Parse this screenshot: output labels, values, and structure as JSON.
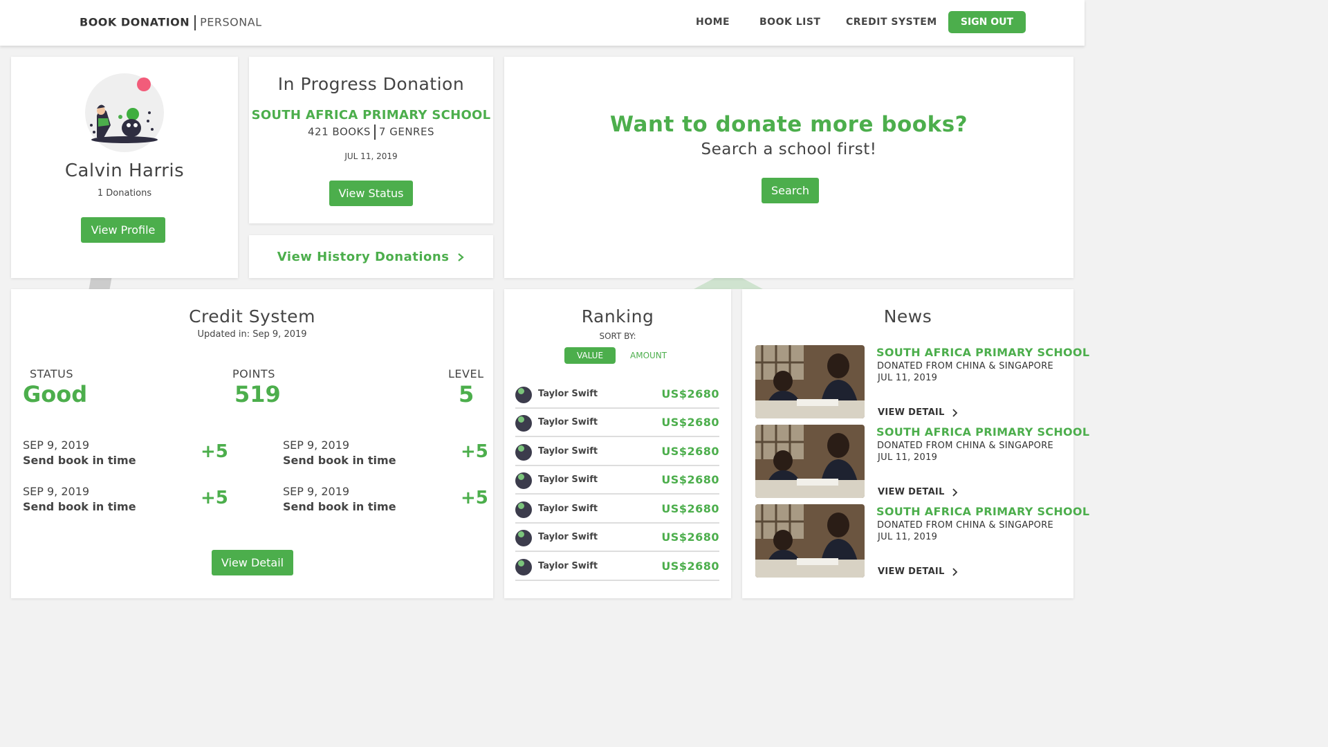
{
  "header": {
    "brand_main": "BOOK DONATION",
    "brand_sub": "PERSONAL",
    "nav": [
      "HOME",
      "BOOK LIST",
      "CREDIT SYSTEM"
    ],
    "signout": "SIGN OUT"
  },
  "profile": {
    "name": "Calvin Harris",
    "donations": "1 Donations",
    "button": "View Profile"
  },
  "in_progress": {
    "title": "In Progress Donation",
    "school": "SOUTH AFRICA PRIMARY SCHOOL",
    "books": "421 BOOKS",
    "genres": "7 GENRES",
    "date": "JUL 11, 2019",
    "button": "View Status"
  },
  "history": {
    "label": "View History Donations",
    "icon": "chevron-right-icon"
  },
  "promo": {
    "title": "Want to donate more books?",
    "subtitle": "Search a school first!",
    "button": "Search"
  },
  "credit": {
    "title": "Credit System",
    "updated": "Updated in: Sep 9, 2019",
    "status_label": "STATUS",
    "status_value": "Good",
    "points_label": "POINTS",
    "points_value": "519",
    "level_label": "LEVEL",
    "level_value": "5",
    "history": [
      {
        "date": "SEP 9, 2019",
        "desc": "Send book in time",
        "points": "+5"
      },
      {
        "date": "SEP 9, 2019",
        "desc": "Send book in time",
        "points": "+5"
      },
      {
        "date": "SEP 9, 2019",
        "desc": "Send book in time",
        "points": "+5"
      },
      {
        "date": "SEP 9, 2019",
        "desc": "Send book in time",
        "points": "+5"
      }
    ],
    "button": "View Detail"
  },
  "ranking": {
    "title": "Ranking",
    "sort_label": "SORT BY:",
    "sort_value": "VALUE",
    "sort_amount": "AMOUNT",
    "rows": [
      {
        "name": "Taylor Swift",
        "value": "US$2680"
      },
      {
        "name": "Taylor Swift",
        "value": "US$2680"
      },
      {
        "name": "Taylor Swift",
        "value": "US$2680"
      },
      {
        "name": "Taylor Swift",
        "value": "US$2680"
      },
      {
        "name": "Taylor Swift",
        "value": "US$2680"
      },
      {
        "name": "Taylor Swift",
        "value": "US$2680"
      },
      {
        "name": "Taylor Swift",
        "value": "US$2680"
      }
    ]
  },
  "news": {
    "title": "News",
    "items": [
      {
        "school": "SOUTH AFRICA PRIMARY SCHOOL",
        "from": "DONATED FROM CHINA & SINGAPORE",
        "date": "JUL 11, 2019",
        "link": "VIEW DETAIL"
      },
      {
        "school": "SOUTH AFRICA PRIMARY SCHOOL",
        "from": "DONATED FROM CHINA & SINGAPORE",
        "date": "JUL 11, 2019",
        "link": "VIEW DETAIL"
      },
      {
        "school": "SOUTH AFRICA PRIMARY SCHOOL",
        "from": "DONATED FROM CHINA & SINGAPORE",
        "date": "JUL 11, 2019",
        "link": "VIEW DETAIL"
      }
    ]
  },
  "colors": {
    "accent": "#4cae4c",
    "background": "#f2f2f2"
  }
}
